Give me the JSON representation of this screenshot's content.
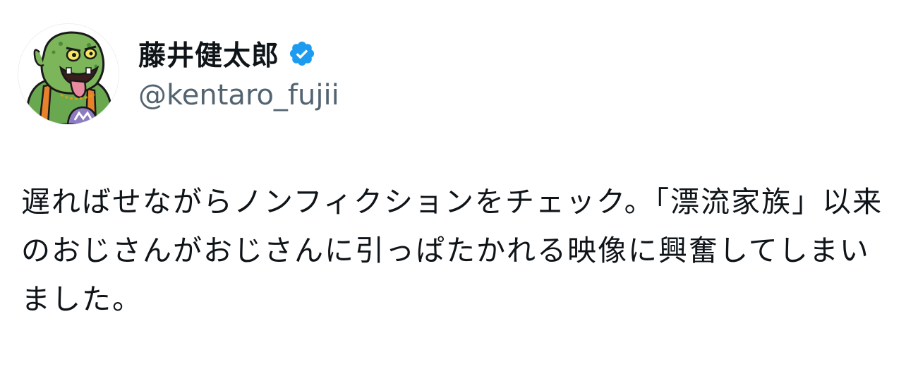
{
  "author": {
    "display_name": "藤井健太郎",
    "handle": "@kentaro_fujii",
    "verified": true,
    "avatar_icon": "green-monster-avatar-icon",
    "verified_icon": "verified-badge-icon"
  },
  "tweet": {
    "text": "遅ればせながらノンフィクションをチェック。「漂流家族」以来のおじさんがおじさんに引っぱたかれる映像に興奮してしまいました。"
  },
  "colors": {
    "verified_blue": "#1d9bf0",
    "text_primary": "#0f1419",
    "text_secondary": "#536471",
    "avatar_green": "#6aa84f"
  }
}
